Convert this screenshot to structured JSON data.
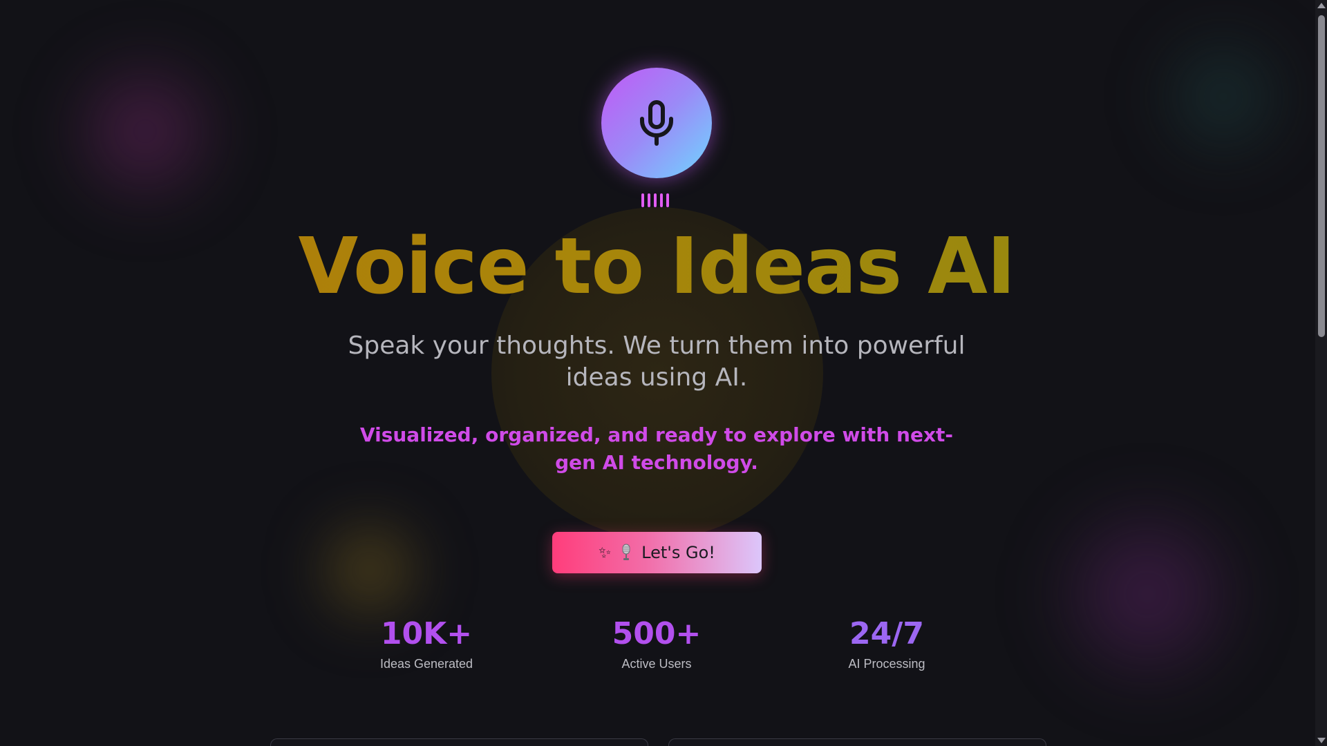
{
  "hero": {
    "mic_icon": "microphone-icon",
    "title": "Voice to Ideas AI",
    "subtitle": "Speak your thoughts. We turn them into powerful ideas using AI.",
    "tagline": "Visualized, organized, and ready to explore with next-gen AI technology."
  },
  "cta": {
    "label": "Let's Go!",
    "icons": [
      "sparkle-icon",
      "studio-microphone-icon"
    ]
  },
  "stats": [
    {
      "value": "10K+",
      "label": "Ideas Generated"
    },
    {
      "value": "500+",
      "label": "Active Users"
    },
    {
      "value": "24/7",
      "label": "AI Processing"
    }
  ],
  "colors": {
    "background": "#121217",
    "title_gradient_start": "#b37a0a",
    "title_gradient_end": "#8f8a12",
    "tagline": "#d04be8",
    "stat_value": "#b250ee",
    "cta_gradient_start": "#ff3d7b",
    "cta_gradient_end": "#dcc6fb",
    "mic_gradient_start": "#c159f5",
    "mic_gradient_end": "#6fd6ff"
  }
}
